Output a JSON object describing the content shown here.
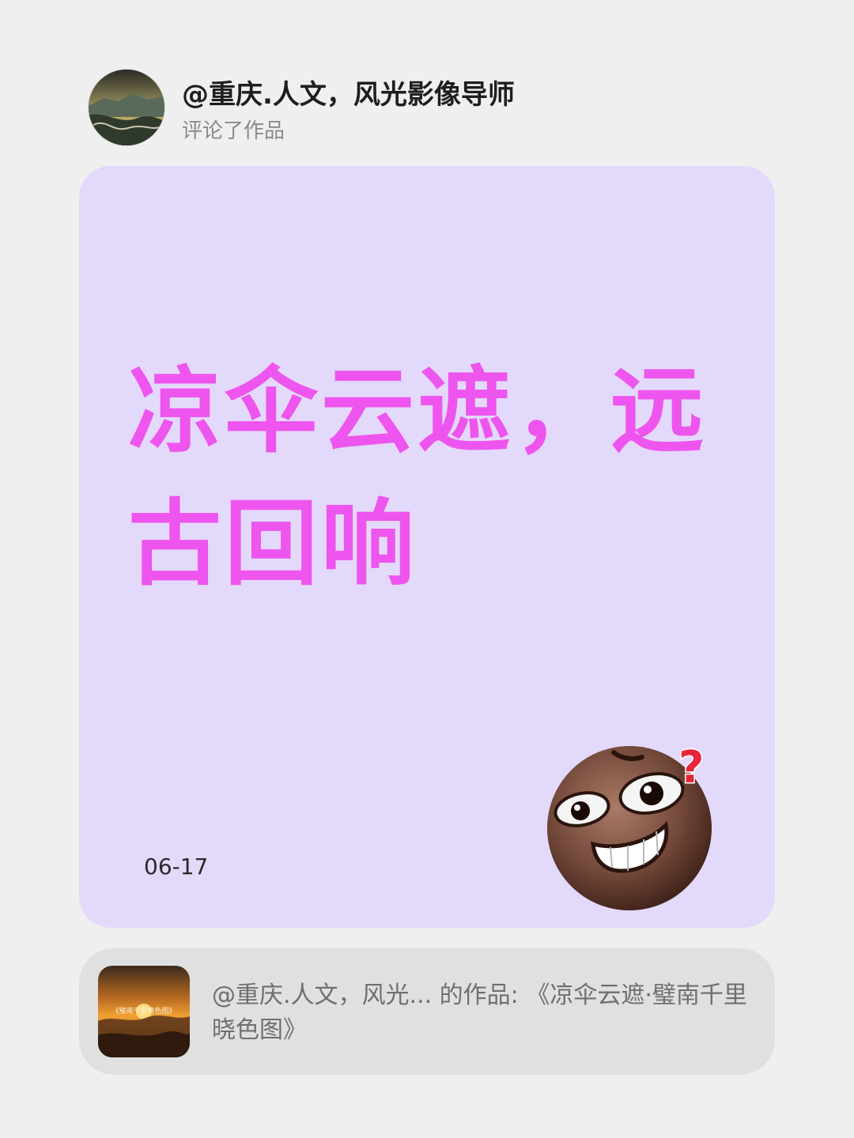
{
  "header": {
    "user_name": "@重庆.人文，风光影像导师",
    "action": "评论了作品",
    "avatar_icon": "landscape-avatar"
  },
  "comment": {
    "text": "凉伞云遮，远古回响",
    "date": "06-17",
    "sticker_icon": "confused-grin-emoji",
    "background_color": "#e3d9fb",
    "text_color": "#ee55ee"
  },
  "work": {
    "description": "@重庆.人文，风光... 的作品: 《凉伞云遮·璧南千里晓色图》",
    "thumbnail_caption": "《璧南千里晓色图》"
  }
}
